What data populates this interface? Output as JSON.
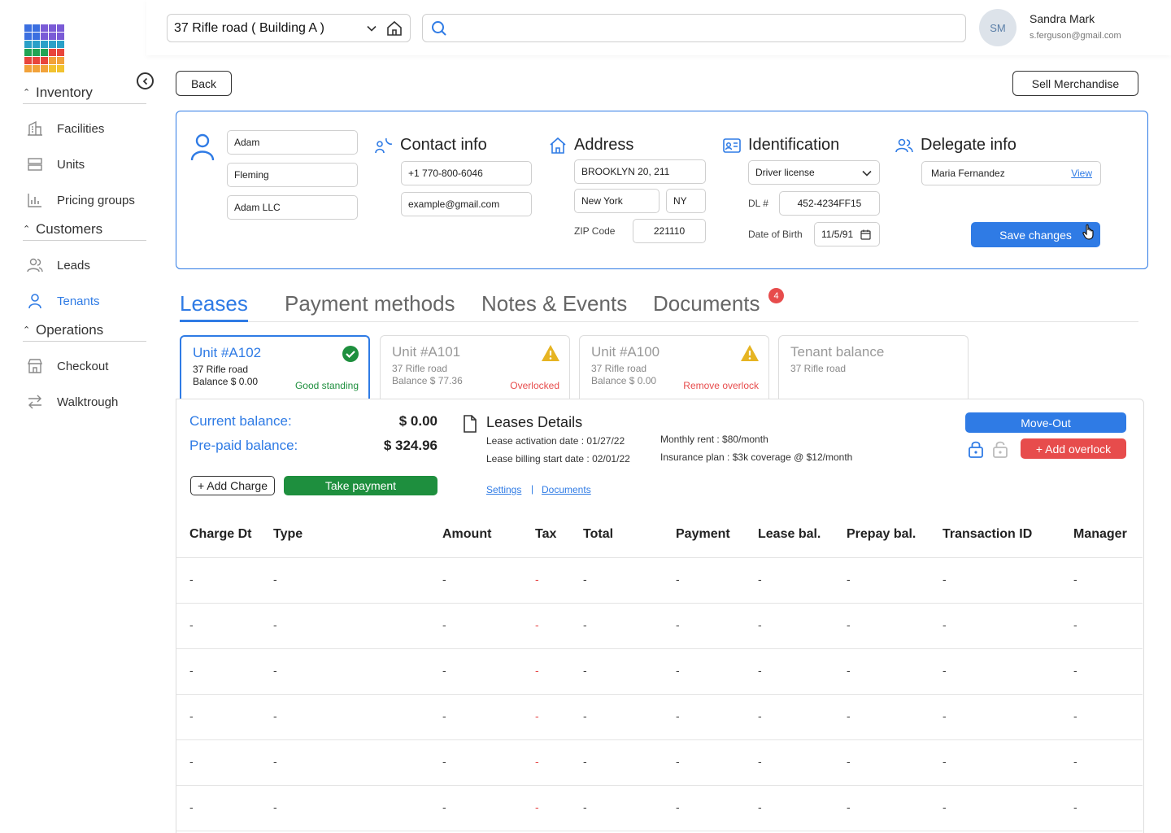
{
  "colors": {
    "accent": "#2f7be5",
    "success": "#1e8f3e",
    "danger": "#e74c4c",
    "warning": "#e6b422"
  },
  "logo": {
    "icon": "app-grid-logo",
    "colors": [
      "#3b6fe0",
      "#3b6fe0",
      "#7a5bd6",
      "#7a5bd6",
      "#7a5bd6",
      "#3b6fe0",
      "#3b6fe0",
      "#7a5bd6",
      "#7a5bd6",
      "#7a5bd6",
      "#2aa0c8",
      "#2aa0c8",
      "#2aa0c8",
      "#2aa0c8",
      "#2aa0c8",
      "#22a455",
      "#22a455",
      "#22a455",
      "#e8453c",
      "#e8453c",
      "#e8453c",
      "#e8453c",
      "#e8453c",
      "#f2a23a",
      "#f2a23a",
      "#f2a23a",
      "#f2a23a",
      "#f2a23a",
      "#f2c230",
      "#f2c230"
    ]
  },
  "sidebar": {
    "sections": [
      {
        "title": "Inventory",
        "items": [
          {
            "label": "Facilities",
            "icon": "building-icon"
          },
          {
            "label": "Units",
            "icon": "units-icon"
          },
          {
            "label": "Pricing groups",
            "icon": "chart-icon"
          }
        ]
      },
      {
        "title": "Customers",
        "items": [
          {
            "label": "Leads",
            "icon": "people-icon"
          },
          {
            "label": "Tenants",
            "icon": "person-icon",
            "active": true
          }
        ]
      },
      {
        "title": "Operations",
        "items": [
          {
            "label": "Checkout",
            "icon": "store-icon"
          },
          {
            "label": "Walktrough",
            "icon": "swap-icon"
          }
        ]
      }
    ]
  },
  "topbar": {
    "building": "37 Rifle road ( Building A )",
    "search_placeholder": "",
    "user": {
      "initials": "SM",
      "name": "Sandra Mark",
      "email": "s.ferguson@gmail.com"
    }
  },
  "actions": {
    "back": "Back",
    "sell": "Sell Merchandise"
  },
  "tenant": {
    "first_name": "Adam",
    "last_name": "Fleming",
    "company": "Adam LLC",
    "contact_title": "Contact info",
    "phone": "+1 770-800-6046",
    "email": "example@gmail.com",
    "address_title": "Address",
    "street": "BROOKLYN 20, 211",
    "city": "New York",
    "state": "NY",
    "zip_label": "ZIP Code",
    "zip": "221110",
    "id_title": "Identification",
    "id_type": "Driver license",
    "dl_label": "DL #",
    "dl_number": "452-4234FF15",
    "dob_label": "Date of Birth",
    "dob": "11/5/91",
    "delegate_title": "Delegate info",
    "delegate_name": "Maria Fernandez",
    "delegate_view": "View",
    "save": "Save changes"
  },
  "tabs": [
    {
      "label": "Leases",
      "active": true
    },
    {
      "label": "Payment methods"
    },
    {
      "label": "Notes & Events"
    },
    {
      "label": "Documents",
      "badge": "4"
    }
  ],
  "units": [
    {
      "title": "Unit #A102",
      "address": "37 Rifle road",
      "balance": "Balance $ 0.00",
      "status": "Good standing",
      "status_color": "#1e8f3e",
      "icon": "check-circle-icon",
      "active": true
    },
    {
      "title": "Unit #A101",
      "address": "37 Rifle road",
      "balance": "Balance $ 77.36",
      "status": "Overlocked",
      "status_color": "#e74c4c",
      "icon": "warning-icon"
    },
    {
      "title": "Unit #A100",
      "address": "37 Rifle road",
      "balance": "Balance $ 0.00",
      "status": "Remove overlock",
      "status_color": "#e74c4c",
      "icon": "warning-icon"
    },
    {
      "title": "Tenant balance",
      "address": "37 Rifle road",
      "balance": "",
      "status": ""
    }
  ],
  "lease": {
    "current_label": "Current balance:",
    "current_value": "$ 0.00",
    "prepaid_label": "Pre-paid balance:",
    "prepaid_value": "$ 324.96",
    "add_charge": "+ Add Charge",
    "take_payment": "Take payment",
    "details_title": "Leases Details",
    "activation": "Lease activation date : 01/27/22",
    "billing_start": "Lease billing start date : 02/01/22",
    "monthly_rent": "Monthly rent : $80/month",
    "insurance": "Insurance plan : $3k coverage @ $12/month",
    "settings_link": "Settings",
    "separator": "|",
    "documents_link": "Documents",
    "move_out": "Move-Out",
    "add_overlock": "+ Add overlock"
  },
  "table": {
    "headers": [
      "Charge Dt",
      "Type",
      "Amount",
      "Tax",
      "Total",
      "Payment",
      "Lease bal.",
      "Prepay bal.",
      "Transaction ID",
      "Manager"
    ],
    "rows": [
      [
        "-",
        "-",
        "-",
        "-",
        "-",
        "-",
        "-",
        "-",
        "-",
        "-"
      ],
      [
        "-",
        "-",
        "-",
        "-",
        "-",
        "-",
        "-",
        "-",
        "-",
        "-"
      ],
      [
        "-",
        "-",
        "-",
        "-",
        "-",
        "-",
        "-",
        "-",
        "-",
        "-"
      ],
      [
        "-",
        "-",
        "-",
        "-",
        "-",
        "-",
        "-",
        "-",
        "-",
        "-"
      ],
      [
        "-",
        "-",
        "-",
        "-",
        "-",
        "-",
        "-",
        "-",
        "-",
        "-"
      ],
      [
        "-",
        "-",
        "-",
        "-",
        "-",
        "-",
        "-",
        "-",
        "-",
        "-"
      ]
    ]
  }
}
